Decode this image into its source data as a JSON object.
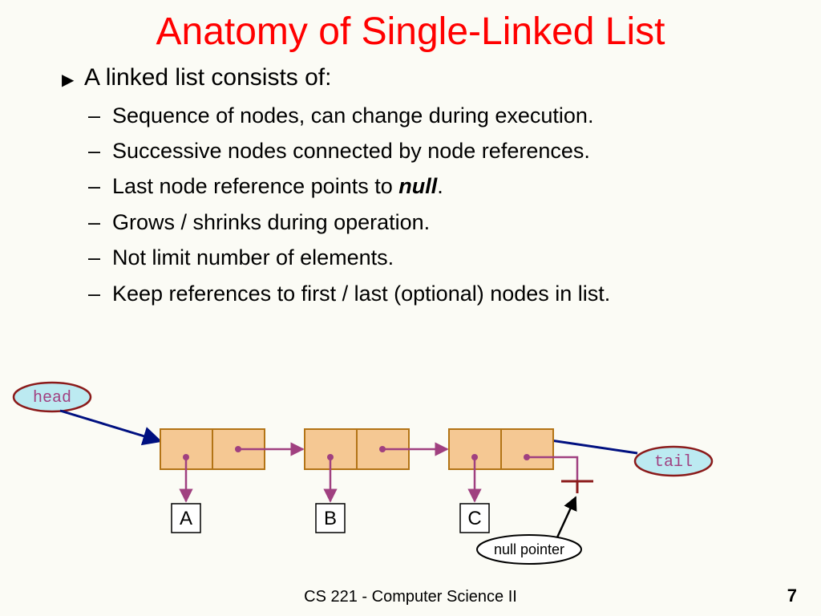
{
  "title": "Anatomy of Single-Linked List",
  "bullets": {
    "top": "A linked list consists of:",
    "items": [
      "Sequence of nodes, can change during execution.",
      "Successive nodes connected by node references.",
      "Last node reference points to ",
      "Grows / shrinks during operation.",
      "Not limit number of elements.",
      "Keep references to first / last (optional) nodes in list."
    ],
    "null_word": "null",
    "null_suffix": "."
  },
  "diagram": {
    "head_label": "head",
    "tail_label": "tail",
    "null_pointer_label": "null pointer",
    "nodes": [
      "A",
      "B",
      "C"
    ]
  },
  "footer": "CS 221 - Computer Science II",
  "page_number": "7"
}
